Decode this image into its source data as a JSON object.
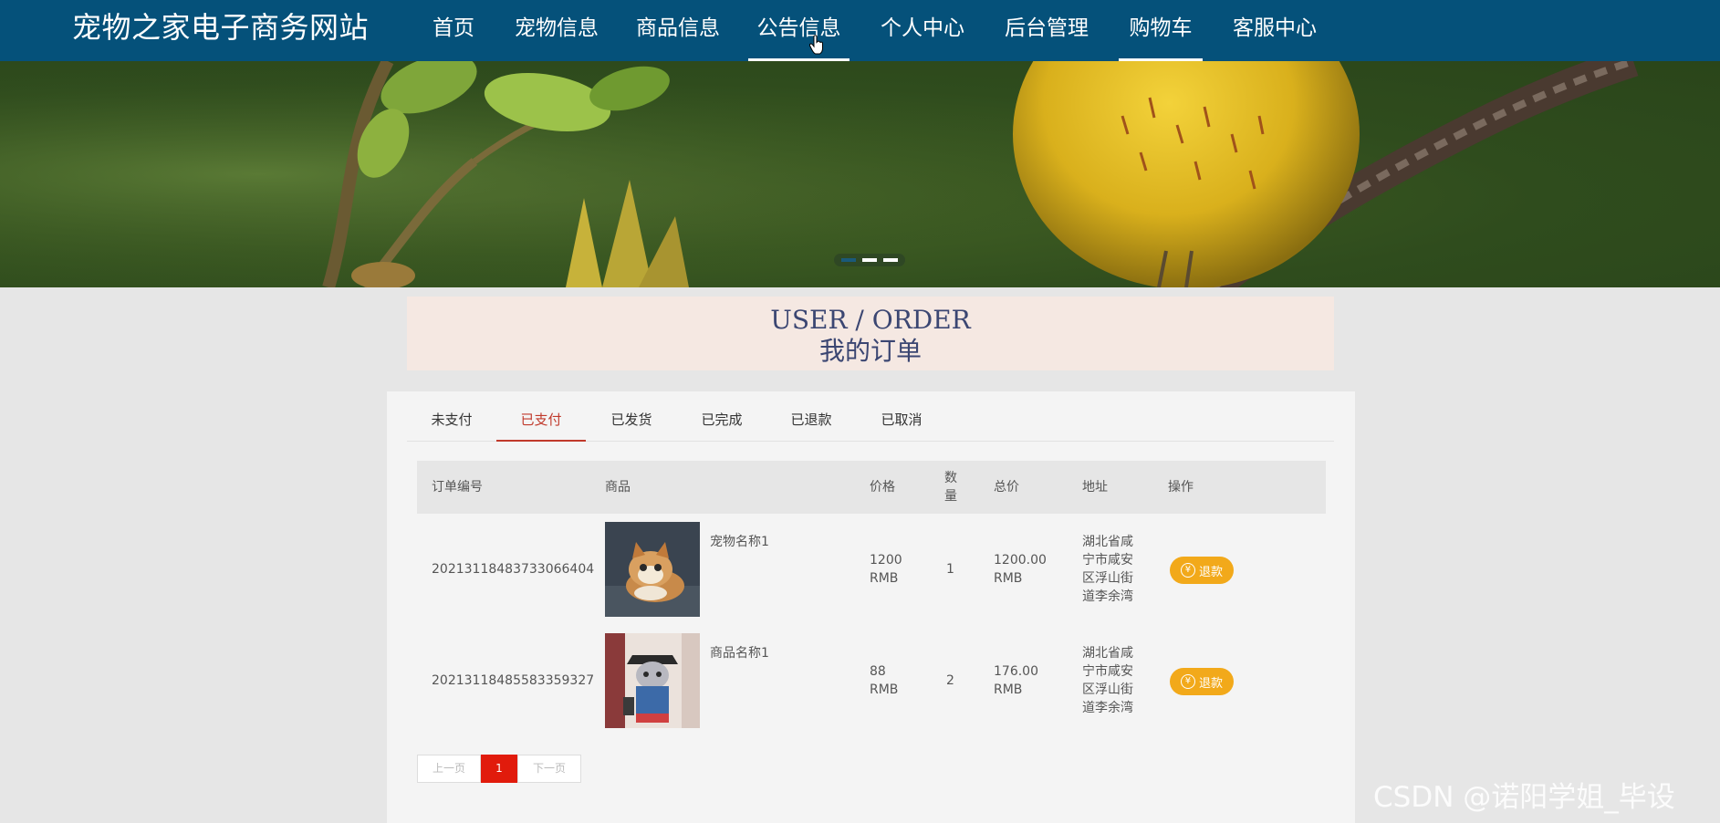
{
  "nav": {
    "brand": "宠物之家电子商务网站",
    "items": [
      {
        "label": "首页"
      },
      {
        "label": "宠物信息"
      },
      {
        "label": "商品信息"
      },
      {
        "label": "公告信息"
      },
      {
        "label": "个人中心"
      },
      {
        "label": "后台管理"
      },
      {
        "label": "购物车"
      },
      {
        "label": "客服中心"
      }
    ]
  },
  "banner": {
    "slide_count": 3,
    "active_slide": 1
  },
  "heading": {
    "en": "USER / ORDER",
    "cn": "我的订单"
  },
  "tabs": [
    {
      "label": "未支付"
    },
    {
      "label": "已支付"
    },
    {
      "label": "已发货"
    },
    {
      "label": "已完成"
    },
    {
      "label": "已退款"
    },
    {
      "label": "已取消"
    }
  ],
  "active_tab": "已支付",
  "table": {
    "headers": {
      "order_no": "订单编号",
      "product": "商品",
      "price": "价格",
      "qty": "数量",
      "total": "总价",
      "address": "地址",
      "action": "操作"
    },
    "rows": [
      {
        "order_no": "20213118483733066404",
        "product_name": "宠物名称1",
        "image": "cat-photo",
        "price": "1200 RMB",
        "qty": "1",
        "total": "1200.00 RMB",
        "address": "湖北省咸宁市咸安区浮山街道李余湾",
        "action": "退款"
      },
      {
        "order_no": "20213118485583359327",
        "product_name": "商品名称1",
        "image": "cat-costume-photo",
        "price": "88 RMB",
        "qty": "2",
        "total": "176.00 RMB",
        "address": "湖北省咸宁市咸安区浮山街道李余湾",
        "action": "退款"
      }
    ]
  },
  "pager": {
    "prev": "上一页",
    "current": "1",
    "next": "下一页"
  },
  "watermark": "CSDN @诺阳学姐_毕设",
  "colors": {
    "nav_bg": "#05517a",
    "accent_red": "#c0392b",
    "refund_btn": "#f2a91a",
    "page_current": "#e11b0c"
  }
}
